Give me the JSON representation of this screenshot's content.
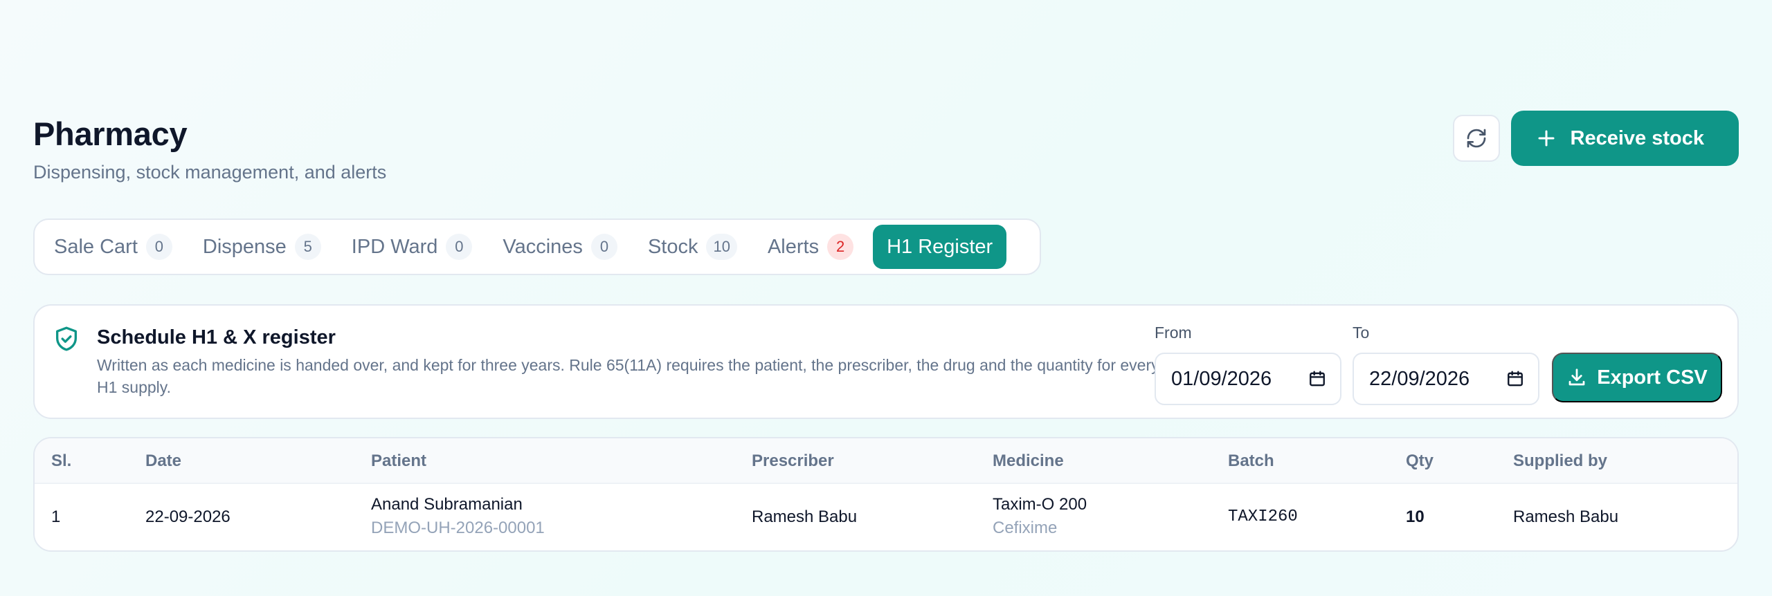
{
  "header": {
    "title": "Pharmacy",
    "subtitle": "Dispensing, stock management, and alerts",
    "refresh_icon": "refresh-icon",
    "receive_label": "Receive stock"
  },
  "tabs": [
    {
      "label": "Sale Cart",
      "count": "0"
    },
    {
      "label": "Dispense",
      "count": "5"
    },
    {
      "label": "IPD Ward",
      "count": "0"
    },
    {
      "label": "Vaccines",
      "count": "0"
    },
    {
      "label": "Stock",
      "count": "10"
    },
    {
      "label": "Alerts",
      "count": "2"
    },
    {
      "label": "H1 Register",
      "active": true
    }
  ],
  "register": {
    "icon": "shield-check-icon",
    "title": "Schedule H1 & X register",
    "description": "Written as each medicine is handed over, and kept for three years. Rule 65(11A) requires the patient, the prescriber, the drug and the quantity for every H1 supply.",
    "from_label": "From",
    "from_value": "01/09/2026",
    "to_label": "To",
    "to_value": "22/09/2026",
    "export_label": "Export CSV"
  },
  "table": {
    "columns": [
      "Sl.",
      "Date",
      "Patient",
      "Prescriber",
      "Medicine",
      "Batch",
      "Qty",
      "Supplied by"
    ],
    "rows": [
      {
        "sl": "1",
        "date": "22-09-2026",
        "patient_name": "Anand Subramanian",
        "patient_id": "DEMO-UH-2026-00001",
        "prescriber": "Ramesh Babu",
        "medicine_name": "Taxim-O 200",
        "medicine_generic": "Cefixime",
        "batch": "TAXI260",
        "qty": "10",
        "supplied_by": "Ramesh Babu"
      }
    ]
  },
  "colors": {
    "accent": "#0f9688",
    "alert_badge_bg": "#fee2e2",
    "alert_badge_text": "#dc2626"
  }
}
